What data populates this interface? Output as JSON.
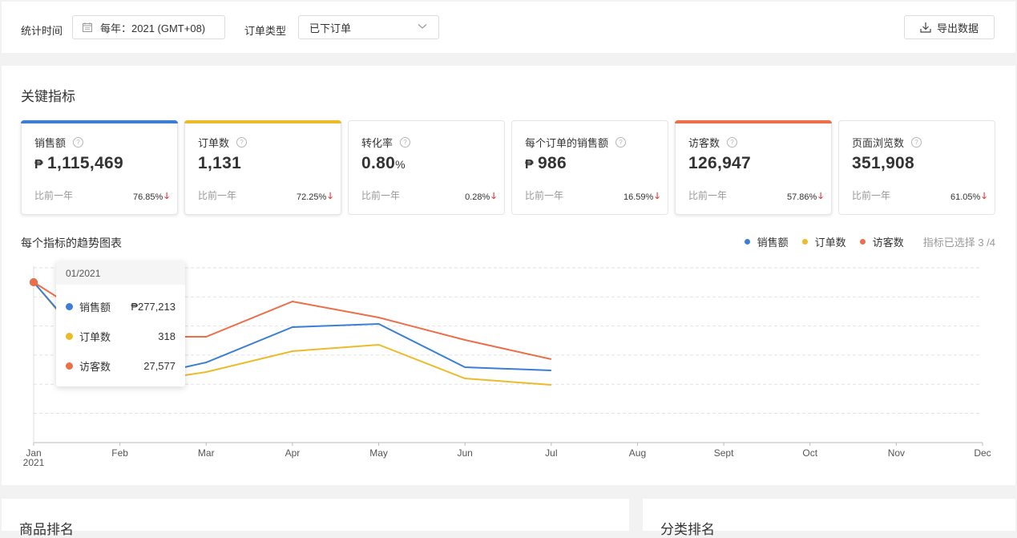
{
  "filters": {
    "period_label": "统计时间",
    "period_value": "每年：2021 (GMT+08)",
    "order_type_label": "订单类型",
    "order_type_value": "已下订单",
    "export_label": "导出数据"
  },
  "metrics": {
    "title": "关键指标",
    "compare_label": "比前一年",
    "cards": [
      {
        "name": "销售额",
        "currency": "₱",
        "value": "1,115,469",
        "unit": "",
        "change": "76.85%",
        "direction": "down",
        "selected": true,
        "color": "#3a7fd5"
      },
      {
        "name": "订单数",
        "currency": "",
        "value": "1,131",
        "unit": "",
        "change": "72.25%",
        "direction": "down",
        "selected": true,
        "color": "#ecbb2a"
      },
      {
        "name": "转化率",
        "currency": "",
        "value": "0.80",
        "unit": "%",
        "change": "0.28%",
        "direction": "down",
        "selected": false,
        "color": ""
      },
      {
        "name": "每个订单的销售额",
        "currency": "₱",
        "value": "986",
        "unit": "",
        "change": "16.59%",
        "direction": "down",
        "selected": false,
        "color": ""
      },
      {
        "name": "访客数",
        "currency": "",
        "value": "126,947",
        "unit": "",
        "change": "57.86%",
        "direction": "down",
        "selected": true,
        "color": "#ec6f4a"
      },
      {
        "name": "页面浏览数",
        "currency": "",
        "value": "351,908",
        "unit": "",
        "change": "61.05%",
        "direction": "down",
        "selected": false,
        "color": ""
      }
    ]
  },
  "trend": {
    "title": "每个指标的趋势图表",
    "legend": [
      {
        "name": "销售额",
        "color": "#3a7fd5"
      },
      {
        "name": "订单数",
        "color": "#ecbb2a"
      },
      {
        "name": "访客数",
        "color": "#ec6f4a"
      }
    ],
    "selected_count": "指标已选择 3 /4"
  },
  "tooltip": {
    "date": "01/2021",
    "rows": [
      {
        "label": "销售额",
        "value": "₱277,213",
        "color": "#3a7fd5"
      },
      {
        "label": "订单数",
        "value": "318",
        "color": "#ecbb2a"
      },
      {
        "label": "访客数",
        "value": "27,577",
        "color": "#ec6f4a"
      }
    ]
  },
  "chart_data": {
    "type": "line",
    "categories": [
      "Jan",
      "Feb",
      "Mar",
      "Apr",
      "May",
      "Jun",
      "Jul",
      "Aug",
      "Sept",
      "Oct",
      "Nov",
      "Dec"
    ],
    "year_label": "2021",
    "series": [
      {
        "name": "销售额",
        "color": "#3a7fd5",
        "values": [
          1.0,
          0.38,
          0.5,
          0.72,
          0.74,
          0.47,
          0.45,
          null,
          null,
          null,
          null,
          null
        ]
      },
      {
        "name": "订单数",
        "color": "#ecbb2a",
        "values": [
          1.0,
          0.36,
          0.44,
          0.57,
          0.61,
          0.4,
          0.36,
          null,
          null,
          null,
          null,
          null
        ]
      },
      {
        "name": "访客数",
        "color": "#ec6f4a",
        "values": [
          1.0,
          0.66,
          0.66,
          0.88,
          0.78,
          0.64,
          0.52,
          null,
          null,
          null,
          null,
          null
        ]
      }
    ],
    "ylim": [
      0,
      1.1
    ],
    "grid": true,
    "legend_position": "top-right"
  },
  "ranking": {
    "left_title": "商品排名",
    "right_title": "分类排名"
  }
}
